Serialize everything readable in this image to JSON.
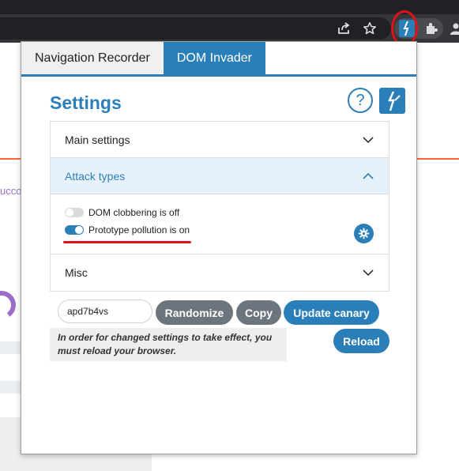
{
  "popup": {
    "tabs": [
      {
        "label": "Navigation Recorder"
      },
      {
        "label": "DOM Invader"
      }
    ],
    "title": "Settings",
    "help_label": "?",
    "sections": [
      {
        "label": "Main settings"
      },
      {
        "label": "Attack types"
      },
      {
        "label": "Misc"
      }
    ],
    "toggles": [
      {
        "label": "DOM clobbering is off",
        "state": "off"
      },
      {
        "label": "Prototype pollution is on",
        "state": "on"
      }
    ],
    "canary": {
      "value": "apd7b4vs"
    },
    "buttons": {
      "randomize": "Randomize",
      "copy": "Copy",
      "update_canary": "Update canary",
      "reload": "Reload"
    },
    "notice": "In order for changed settings to take effect, you must reload your browser."
  },
  "background_page": {
    "partial_text": "ucco"
  },
  "colors": {
    "accent": "#2b7fb9",
    "annotation_red": "#e0131a",
    "button_gray": "#6c757d"
  },
  "icons": [
    "share-icon",
    "star-icon",
    "burp-extension-icon",
    "puzzle-icon",
    "profile-icon",
    "help-icon",
    "burp-logo-icon",
    "chevron-down-icon",
    "chevron-up-icon",
    "gear-icon"
  ]
}
